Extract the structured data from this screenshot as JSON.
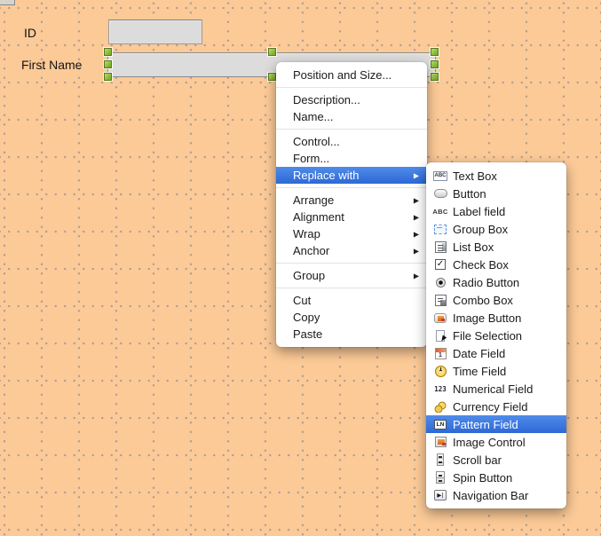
{
  "colors": {
    "canvas_background": "#fcca97",
    "menu_highlight": "#3472d7",
    "selection_handle_green": "#84b43a",
    "field_fill": "#dcdcdc"
  },
  "form_canvas": {
    "fields": [
      {
        "label": "ID",
        "value": "",
        "selected": false
      },
      {
        "label": "First Name",
        "value": "",
        "selected": true
      }
    ]
  },
  "context_menu": {
    "items": [
      {
        "type": "item",
        "label": "Position and Size..."
      },
      {
        "type": "separator"
      },
      {
        "type": "item",
        "label": "Description..."
      },
      {
        "type": "item",
        "label": "Name..."
      },
      {
        "type": "separator"
      },
      {
        "type": "item",
        "label": "Control..."
      },
      {
        "type": "item",
        "label": "Form..."
      },
      {
        "type": "item",
        "label": "Replace with",
        "has_submenu": true,
        "highlighted": true
      },
      {
        "type": "separator"
      },
      {
        "type": "item",
        "label": "Arrange",
        "has_submenu": true
      },
      {
        "type": "item",
        "label": "Alignment",
        "has_submenu": true
      },
      {
        "type": "item",
        "label": "Wrap",
        "has_submenu": true
      },
      {
        "type": "item",
        "label": "Anchor",
        "has_submenu": true
      },
      {
        "type": "separator"
      },
      {
        "type": "item",
        "label": "Group",
        "has_submenu": true
      },
      {
        "type": "separator"
      },
      {
        "type": "item",
        "label": "Cut"
      },
      {
        "type": "item",
        "label": "Copy"
      },
      {
        "type": "item",
        "label": "Paste"
      }
    ]
  },
  "replace_submenu": {
    "items": [
      {
        "label": "Text Box",
        "icon": "text-box-icon",
        "icon_text": "ABC"
      },
      {
        "label": "Button",
        "icon": "button-icon"
      },
      {
        "label": "Label field",
        "icon": "label-field-icon",
        "icon_text": "ABC"
      },
      {
        "label": "Group Box",
        "icon": "group-box-icon"
      },
      {
        "label": "List Box",
        "icon": "list-box-icon"
      },
      {
        "label": "Check Box",
        "icon": "check-box-icon",
        "icon_text": "✓"
      },
      {
        "label": "Radio Button",
        "icon": "radio-button-icon"
      },
      {
        "label": "Combo Box",
        "icon": "combo-box-icon"
      },
      {
        "label": "Image Button",
        "icon": "image-button-icon"
      },
      {
        "label": "File Selection",
        "icon": "file-selection-icon"
      },
      {
        "label": "Date Field",
        "icon": "date-field-icon",
        "icon_text": "1"
      },
      {
        "label": "Time Field",
        "icon": "time-field-icon"
      },
      {
        "label": "Numerical Field",
        "icon": "numerical-field-icon",
        "icon_text": "123"
      },
      {
        "label": "Currency Field",
        "icon": "currency-field-icon"
      },
      {
        "label": "Pattern Field",
        "icon": "pattern-field-icon",
        "icon_text": "LN",
        "highlighted": true
      },
      {
        "label": "Image Control",
        "icon": "image-control-icon"
      },
      {
        "label": "Scroll bar",
        "icon": "scroll-bar-icon"
      },
      {
        "label": "Spin Button",
        "icon": "spin-button-icon"
      },
      {
        "label": "Navigation Bar",
        "icon": "navigation-bar-icon",
        "icon_text": "▶|"
      }
    ]
  }
}
